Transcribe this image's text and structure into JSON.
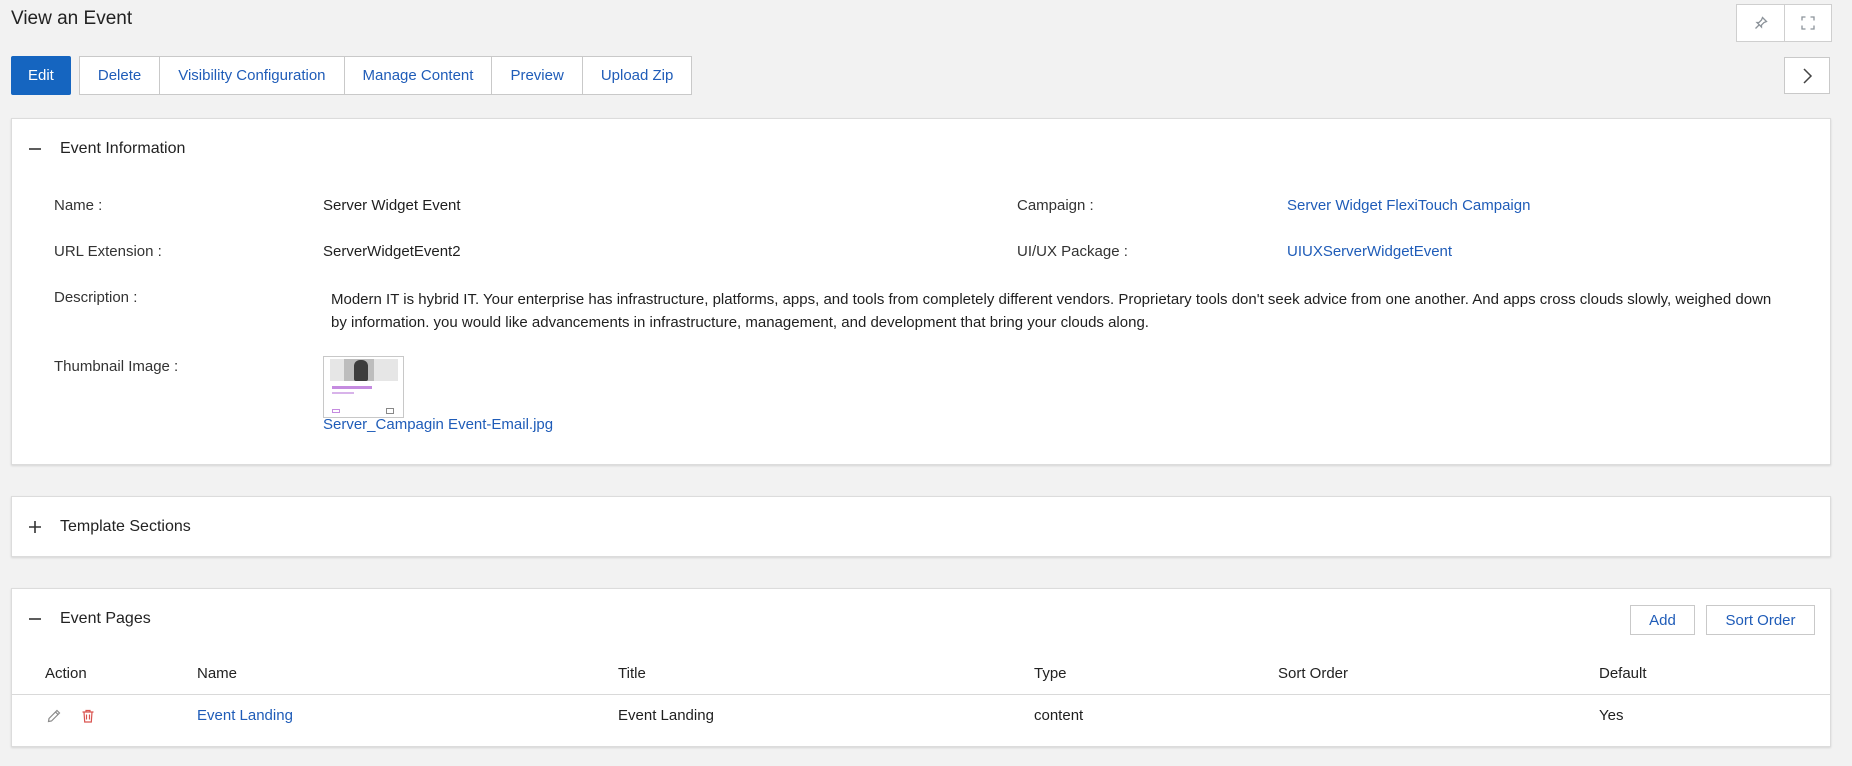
{
  "page": {
    "title": "View an Event"
  },
  "toolbar": {
    "edit": "Edit",
    "delete": "Delete",
    "visibility": "Visibility Configuration",
    "manage_content": "Manage Content",
    "preview": "Preview",
    "upload_zip": "Upload Zip"
  },
  "top_tools": {
    "pin_icon": "pin-icon",
    "fullscreen_icon": "fullscreen-icon",
    "next_icon": "chevron-right-icon"
  },
  "event_info": {
    "title": "Event Information",
    "name_label": "Name :",
    "name_value": "Server Widget Event",
    "campaign_label": "Campaign :",
    "campaign_value": "Server Widget FlexiTouch Campaign",
    "url_label": "URL Extension :",
    "url_value": "ServerWidgetEvent2",
    "package_label": "UI/UX Package :",
    "package_value": "UIUXServerWidgetEvent",
    "description_label": "Description :",
    "description_value": "Modern IT is hybrid IT. Your enterprise has infrastructure, platforms, apps, and tools from completely different vendors. Proprietary tools don't seek advice from one another. And apps cross clouds slowly, weighed down by information. you would like advancements in infrastructure, management, and development that bring your clouds along.",
    "thumbnail_label": "Thumbnail Image :",
    "thumbnail_file": "Server_Campagin Event-Email.jpg"
  },
  "template_sections": {
    "title": "Template Sections"
  },
  "event_pages": {
    "title": "Event Pages",
    "add": "Add",
    "sort_order": "Sort Order",
    "columns": [
      "Action",
      "Name",
      "Title",
      "Type",
      "Sort Order",
      "Default"
    ],
    "rows": [
      {
        "name": "Event Landing",
        "title": "Event Landing",
        "type": "content",
        "sort_order": "",
        "default": "Yes"
      }
    ]
  },
  "colors": {
    "primary": "#1565c0",
    "link": "#1f5cb8",
    "danger": "#d9534f"
  }
}
